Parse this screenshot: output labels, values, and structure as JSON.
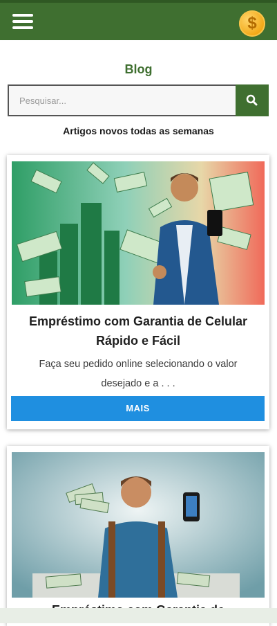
{
  "header": {
    "menu_icon": "hamburger-menu-icon",
    "coin_icon": "dollar-coin-icon",
    "coin_symbol": "$"
  },
  "page": {
    "title": "Blog",
    "tagline": "Artigos novos todas as semanas"
  },
  "search": {
    "placeholder": "Pesquisar...",
    "button_icon": "search-icon"
  },
  "posts": [
    {
      "title": "Empréstimo com Garantia de Celular Rápido e Fácil",
      "excerpt": "Faça seu pedido online selecionando o valor desejado e a . . .",
      "button_label": "MAIS"
    },
    {
      "title": "Empréstimo com Garantia de"
    }
  ],
  "colors": {
    "brand_green": "#3f6f30",
    "button_blue": "#1f8fe0"
  }
}
